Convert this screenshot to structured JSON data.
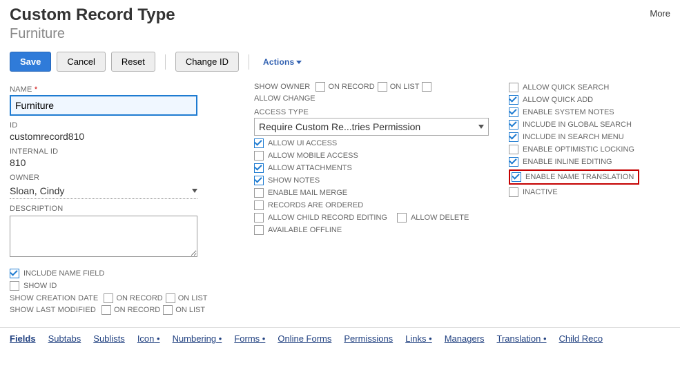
{
  "header": {
    "title": "Custom Record Type",
    "subtitle": "Furniture",
    "more": "More"
  },
  "buttons": {
    "save": "Save",
    "cancel": "Cancel",
    "reset": "Reset",
    "change_id": "Change ID",
    "actions": "Actions"
  },
  "left": {
    "name_label": "NAME",
    "name_value": "Furniture",
    "id_label": "ID",
    "id_value": "customrecord810",
    "internal_id_label": "INTERNAL ID",
    "internal_id_value": "810",
    "owner_label": "OWNER",
    "owner_value": "Sloan, Cindy",
    "description_label": "DESCRIPTION",
    "description_value": "",
    "include_name_field": "INCLUDE NAME FIELD",
    "show_id": "SHOW ID",
    "show_creation_date": "SHOW CREATION DATE",
    "show_last_modified": "SHOW LAST MODIFIED",
    "on_record": "ON RECORD",
    "on_list": "ON LIST"
  },
  "mid": {
    "show_owner": "SHOW OWNER",
    "on_record": "ON RECORD",
    "on_list": "ON LIST",
    "allow_change": "ALLOW CHANGE",
    "access_type_label": "ACCESS TYPE",
    "access_type_value": "Require Custom Re...tries Permission",
    "allow_ui_access": "ALLOW UI ACCESS",
    "allow_mobile_access": "ALLOW MOBILE ACCESS",
    "allow_attachments": "ALLOW ATTACHMENTS",
    "show_notes": "SHOW NOTES",
    "enable_mail_merge": "ENABLE MAIL MERGE",
    "records_are_ordered": "RECORDS ARE ORDERED",
    "allow_child_record_editing": "ALLOW CHILD RECORD EDITING",
    "allow_delete": "ALLOW DELETE",
    "available_offline": "AVAILABLE OFFLINE"
  },
  "right": {
    "allow_quick_search": "ALLOW QUICK SEARCH",
    "allow_quick_add": "ALLOW QUICK ADD",
    "enable_system_notes": "ENABLE SYSTEM NOTES",
    "include_in_global_search": "INCLUDE IN GLOBAL SEARCH",
    "include_in_search_menu": "INCLUDE IN SEARCH MENU",
    "enable_optimistic_locking": "ENABLE OPTIMISTIC LOCKING",
    "enable_inline_editing": "ENABLE INLINE EDITING",
    "enable_name_translation": "ENABLE NAME TRANSLATION",
    "inactive": "INACTIVE"
  },
  "tabs": {
    "fields": "Fields",
    "subtabs": "Subtabs",
    "sublists": "Sublists",
    "icon": "Icon",
    "numbering": "Numbering",
    "forms": "Forms",
    "online_forms": "Online Forms",
    "permissions": "Permissions",
    "links": "Links",
    "managers": "Managers",
    "translation": "Translation",
    "child_records": "Child Reco"
  }
}
